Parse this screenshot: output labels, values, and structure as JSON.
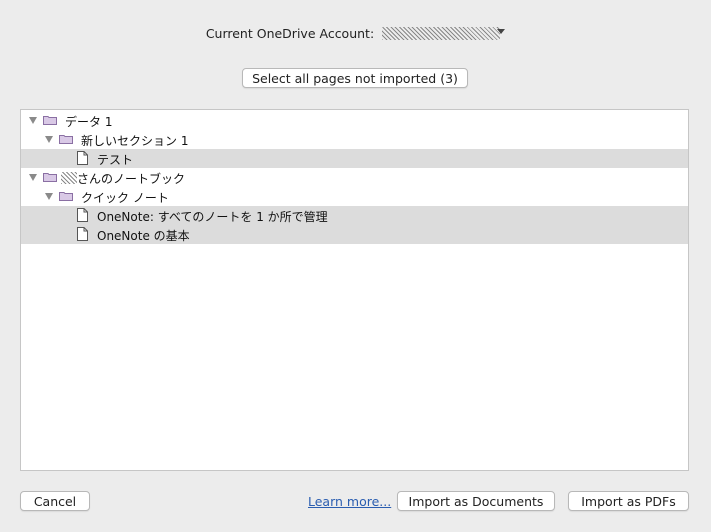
{
  "account": {
    "label": "Current OneDrive Account:",
    "value": ""
  },
  "select_all_button": {
    "label": "Select all pages not imported (3)"
  },
  "tree": {
    "rows": [
      {
        "label": "データ 1",
        "type": "notebook",
        "level": 0,
        "expanded": true,
        "selected": false
      },
      {
        "label": "新しいセクション 1",
        "type": "section",
        "level": 1,
        "expanded": true,
        "selected": false
      },
      {
        "label": "テスト",
        "type": "page",
        "level": 2,
        "selected": true
      },
      {
        "label": "さんのノートブック",
        "type": "notebook",
        "level": 0,
        "expanded": true,
        "selected": false,
        "prefix_redacted": true
      },
      {
        "label": "クイック ノート",
        "type": "section",
        "level": 1,
        "expanded": true,
        "selected": false
      },
      {
        "label": "OneNote: すべてのノートを 1 か所で管理",
        "type": "page",
        "level": 2,
        "selected": true
      },
      {
        "label": "OneNote の基本",
        "type": "page",
        "level": 2,
        "selected": true
      }
    ]
  },
  "footer": {
    "cancel_label": "Cancel",
    "learn_more_label": "Learn more...",
    "import_documents_label": "Import as Documents",
    "import_pdfs_label": "Import as PDFs"
  },
  "colors": {
    "background": "#ececec",
    "selected_row": "#dcdcdc",
    "link": "#2a5db0",
    "folder_fill": "#d9c9e6",
    "folder_stroke": "#8a6fa3"
  }
}
